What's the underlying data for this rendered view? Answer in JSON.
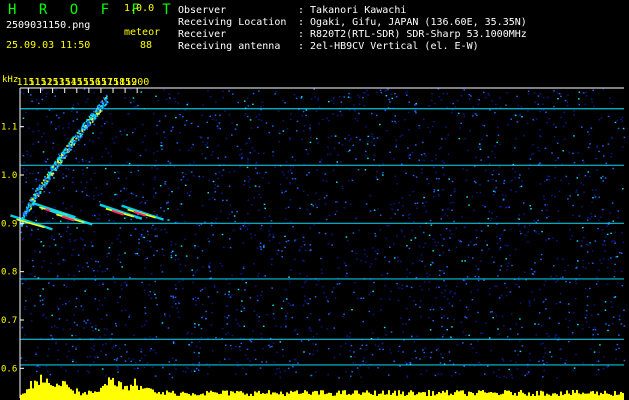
{
  "header": {
    "app_name": "H R O F F T",
    "version": "1.0.0",
    "filename": "2509031150.png",
    "datetime": "25.09.03 11:50",
    "event_label": "meteor",
    "event_count": "88",
    "info": [
      {
        "label": "Observer",
        "value": ": Takanori Kawachi"
      },
      {
        "label": "Receiving Location",
        "value": ": Ogaki, Gifu, JAPAN (136.60E, 35.35N)"
      },
      {
        "label": "Receiver",
        "value": ": R820T2(RTL-SDR) SDR-Sharp 53.1000MHz"
      },
      {
        "label": "Receiving antenna",
        "value": ": 2el-HB9CV Vertical (el. E-W)"
      }
    ]
  },
  "colors": {
    "background": "#000000",
    "noise_low": "#0a1a8c",
    "noise_mid": "#1e64ff",
    "noise_high": "#00e6ff",
    "signal": "#ffff00",
    "strong": "#ff2a6a",
    "tick_text": "#ffff00",
    "header_text": "#ffffff",
    "logo": "#00ff00"
  },
  "chart_data": {
    "type": "heatmap",
    "title": "",
    "xlabel": "",
    "ylabel": "kHz",
    "x_ticks": [
      "1151",
      "1152",
      "1153",
      "1154",
      "1155",
      "1156",
      "1157",
      "1158",
      "1159",
      "1200"
    ],
    "y_ticks": [
      "1.1",
      "1.0",
      "0.9",
      "0.8",
      "0.7",
      "0.6"
    ],
    "ylim": [
      0.58,
      1.18
    ],
    "xlim": [
      1150.3,
      1200.3
    ],
    "grid": true,
    "carriers_khz": [
      1.137,
      1.02,
      0.9,
      0.785,
      0.66,
      0.607
    ],
    "meteor_echoes": [
      {
        "time": 1150.5,
        "freq_khz": 0.9,
        "intensity": "medium"
      },
      {
        "time": 1152.4,
        "freq_khz": 0.925,
        "intensity": "strong"
      },
      {
        "time": 1153.8,
        "freq_khz": 0.91,
        "intensity": "strong"
      },
      {
        "time": 1157.9,
        "freq_khz": 0.922,
        "intensity": "strong"
      },
      {
        "time": 1159.7,
        "freq_khz": 0.92,
        "intensity": "strong"
      }
    ],
    "drifting_carrier": {
      "start": [
        1150.3,
        0.9
      ],
      "end": [
        1157.5,
        1.16
      ]
    },
    "bottom_power": "signal level histogram"
  }
}
